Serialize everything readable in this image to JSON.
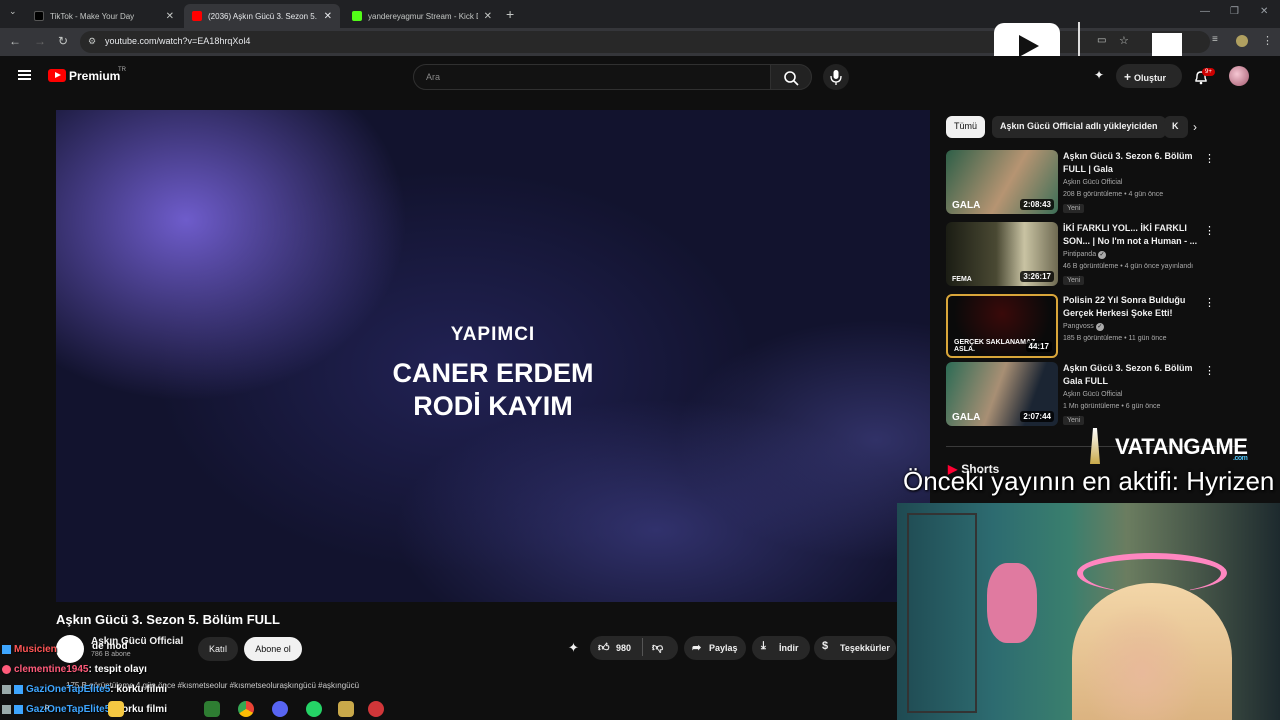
{
  "browser": {
    "tabs": [
      {
        "title": "TikTok - Make Your Day",
        "favicon_color": "#000000"
      },
      {
        "title": "(2036) Aşkın Gücü 3. Sezon 5. B",
        "favicon_color": "#ff0000"
      },
      {
        "title": "yandereyagmur Stream - Kick D",
        "favicon_color": "#53fc18"
      }
    ],
    "url": "youtube.com/watch?v=EA18hrqXol4"
  },
  "youtube": {
    "logo_text": "Premium",
    "country": "TR",
    "search_placeholder": "Ara",
    "create_label": "Oluştur",
    "notif_count": "9+"
  },
  "player": {
    "credit_role": "YAPIMCI",
    "credit_names": [
      "CANER ERDEM",
      "RODİ KAYIM"
    ]
  },
  "video": {
    "title": "Aşkın Gücü 3. Sezon 5. Bölüm FULL",
    "channel": "Aşkın Gücü Official",
    "subs": "786 B abone",
    "join_label": "Katıl",
    "subscribe_label": "Abone ol",
    "likes": "980",
    "share_label": "Paylaş",
    "download_label": "İndir",
    "thanks_label": "Teşekkürler",
    "stats": "175 B görüntüleme  4 gün önce  #kısmetseolur #kısmetseolurașkıngücü #aşkıngücü"
  },
  "sidebar": {
    "chips": [
      "Tümü",
      "Aşkın Gücü Official adlı yükleyiciden",
      "K"
    ],
    "recs": [
      {
        "title": "Aşkın Gücü 3. Sezon 6. Bölüm FULL | Gala",
        "channel": "Aşkın Gücü Official",
        "meta": "208 B görüntüleme • 4 gün önce",
        "badge": "Yeni",
        "duration": "2:08:43",
        "thumb_label": "GALA"
      },
      {
        "title": "İKİ FARKLI YOL... İKİ FARKLI SON... | No I'm not a Human - ...",
        "channel": "Pintipanda",
        "meta": "46 B görüntüleme • 4 gün önce yayınlandı",
        "badge": "Yeni",
        "duration": "3:26:17",
        "thumb_label": "FEMA"
      },
      {
        "title": "Polisin 22 Yıl Sonra Bulduğu Gerçek Herkesi Şoke Etti!",
        "channel": "Pangvoss",
        "meta": "185 B görüntüleme • 11 gün önce",
        "badge": "",
        "duration": "44:17",
        "thumb_label": "GERÇEK SAKLANAMAZ... ASLA."
      },
      {
        "title": "Aşkın Gücü 3. Sezon 6. Bölüm Gala FULL",
        "channel": "Aşkın Gücü Official",
        "meta": "1 Mn görüntüleme • 6 gün önce",
        "badge": "Yeni",
        "duration": "2:07:44",
        "thumb_label": "GALA"
      }
    ],
    "shorts_label": "Shorts"
  },
  "stream": {
    "sponsor": "VATANGAME",
    "sponsor_sub": ".com",
    "top_supporter": "Önceki yayının en aktifi: Hyrizen"
  },
  "chat": [
    {
      "user": "Musicien",
      "msg": "de mod",
      "color": "#ff5555"
    },
    {
      "user": "clementine1945",
      "msg": ": tespit olayı",
      "color": "#ff5b7a"
    },
    {
      "user": "GaziOneTapElite5",
      "msg": ": korku filmi",
      "color": "#3ea6ff"
    },
    {
      "user": "GaziOneTapElite5",
      "msg": ": korku filmi",
      "color": "#3ea6ff"
    }
  ]
}
